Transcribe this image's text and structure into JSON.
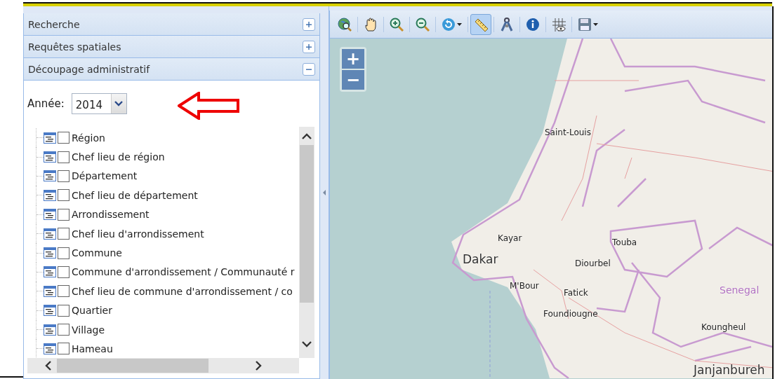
{
  "panels": [
    {
      "title": "Recherche",
      "expanded": false
    },
    {
      "title": "Requêtes spatiales",
      "expanded": false
    },
    {
      "title": "Découpage administratif",
      "expanded": true
    }
  ],
  "year": {
    "label": "Année:",
    "value": "2014"
  },
  "layers": [
    {
      "label": "Région",
      "checked": false
    },
    {
      "label": "Chef lieu de région",
      "checked": false
    },
    {
      "label": "Département",
      "checked": false
    },
    {
      "label": "Chef lieu de département",
      "checked": false
    },
    {
      "label": "Arrondissement",
      "checked": false
    },
    {
      "label": "Chef lieu d'arrondissement",
      "checked": false
    },
    {
      "label": "Commune",
      "checked": false
    },
    {
      "label": "Commune d'arrondissement / Communauté r",
      "checked": false
    },
    {
      "label": "Chef lieu de commune d'arrondissement / co",
      "checked": false
    },
    {
      "label": "Quartier",
      "checked": false
    },
    {
      "label": "Village",
      "checked": false
    },
    {
      "label": "Hameau",
      "checked": false
    }
  ],
  "toolbar": [
    {
      "kind": "globe",
      "selected": false,
      "dropdown": false
    },
    {
      "kind": "pan",
      "selected": false,
      "dropdown": false
    },
    {
      "kind": "zoomin",
      "selected": false,
      "dropdown": false
    },
    {
      "kind": "zoomout",
      "selected": false,
      "dropdown": false
    },
    {
      "kind": "history",
      "selected": false,
      "dropdown": true
    },
    {
      "kind": "ruler",
      "selected": true,
      "dropdown": false
    },
    {
      "kind": "compass",
      "selected": false,
      "dropdown": false
    },
    {
      "kind": "info",
      "selected": false,
      "dropdown": false
    },
    {
      "kind": "grid",
      "selected": false,
      "dropdown": false
    },
    {
      "kind": "save",
      "selected": false,
      "dropdown": true
    }
  ],
  "zoom_buttons": [
    "+",
    "−"
  ],
  "map_labels": [
    {
      "name": "Saint-Louis",
      "kind": "town"
    },
    {
      "name": "Kayar",
      "kind": "town"
    },
    {
      "name": "Dakar",
      "kind": "city"
    },
    {
      "name": "Touba",
      "kind": "town"
    },
    {
      "name": "Diourbel",
      "kind": "town"
    },
    {
      "name": "M'Bour",
      "kind": "town"
    },
    {
      "name": "Fatick",
      "kind": "town"
    },
    {
      "name": "Foundiougne",
      "kind": "town"
    },
    {
      "name": "Senegal",
      "kind": "country"
    },
    {
      "name": "Koungheul",
      "kind": "town"
    },
    {
      "name": "Janjanbureh",
      "kind": "city"
    }
  ]
}
